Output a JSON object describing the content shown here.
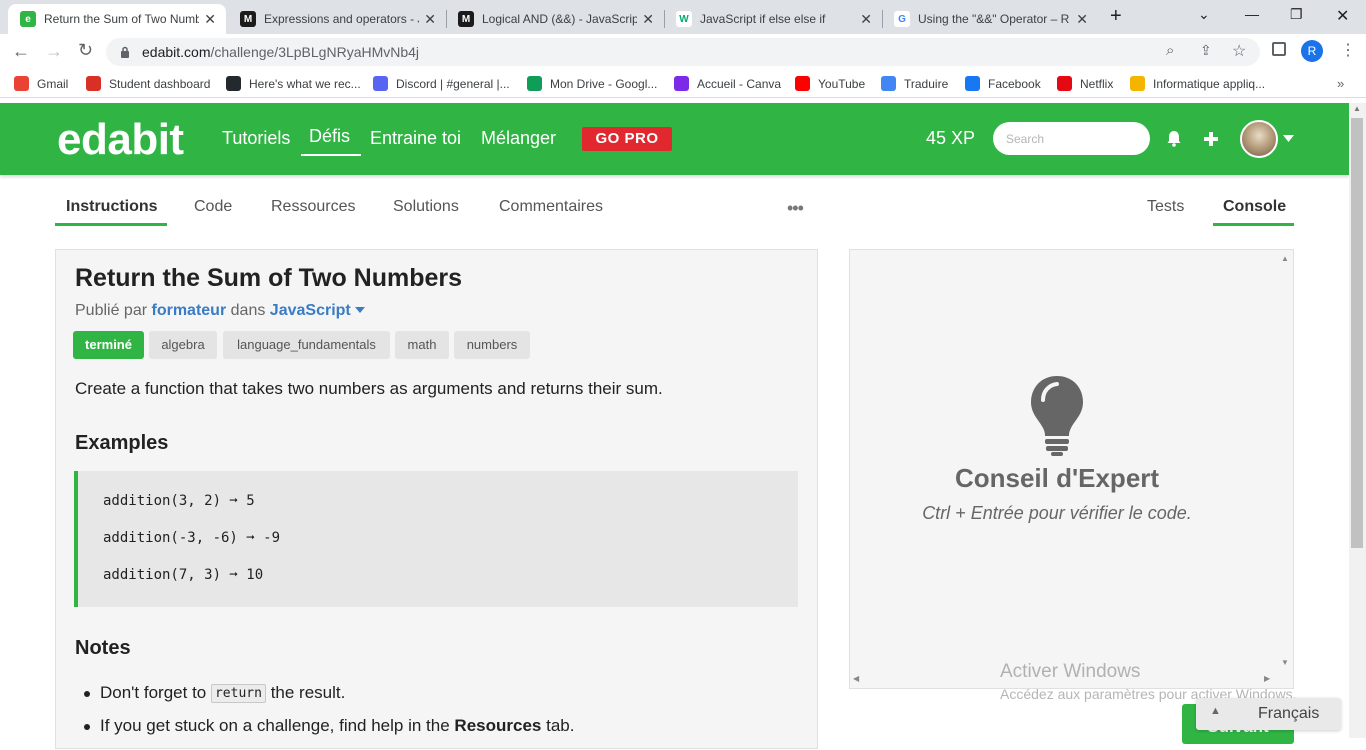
{
  "browser": {
    "tabs": [
      {
        "title": "Return the Sum of Two Numb",
        "favicon_color": "#30b545",
        "favicon_letter": "e"
      },
      {
        "title": "Expressions and operators - J",
        "favicon_color": "#1b1b1b",
        "favicon_letter": "M"
      },
      {
        "title": "Logical AND (&&) - JavaScrip",
        "favicon_color": "#1b1b1b",
        "favicon_letter": "M"
      },
      {
        "title": "JavaScript if else else if",
        "favicon_color": "#04aa6d",
        "favicon_letter": "W"
      },
      {
        "title": "Using the \"&&\" Operator – R",
        "favicon_color": "#4285f4",
        "favicon_letter": "G"
      }
    ],
    "new_tab": "+",
    "url_host": "edabit.com",
    "url_path": "/challenge/3LpBLgNRyaHMvNb4j",
    "profile_letter": "R",
    "bookmarks": [
      {
        "label": "Gmail",
        "color": "#ea4335",
        "icon": "gmail-icon"
      },
      {
        "label": "Student dashboard",
        "color": "#d93025",
        "icon": "dashboard-icon"
      },
      {
        "label": "Here's what we rec...",
        "color": "#24292e",
        "icon": "github-icon"
      },
      {
        "label": "Discord | #general |...",
        "color": "#5865f2",
        "icon": "discord-icon"
      },
      {
        "label": "Mon Drive - Googl...",
        "color": "#0f9d58",
        "icon": "drive-icon"
      },
      {
        "label": "Accueil - Canva",
        "color": "#7d2ae8",
        "icon": "canva-icon"
      },
      {
        "label": "YouTube",
        "color": "#ff0000",
        "icon": "youtube-icon"
      },
      {
        "label": "Traduire",
        "color": "#4285f4",
        "icon": "translate-icon"
      },
      {
        "label": "Facebook",
        "color": "#1877f2",
        "icon": "facebook-icon"
      },
      {
        "label": "Netflix",
        "color": "#e50914",
        "icon": "netflix-icon"
      },
      {
        "label": "Informatique appliq...",
        "color": "#f4b400",
        "icon": "classroom-icon"
      }
    ]
  },
  "site": {
    "logo": "edabit",
    "brand_color": "#30b545",
    "nav": [
      "Tutoriels",
      "Défis",
      "Entraine toi",
      "Mélanger"
    ],
    "go_pro": "GO PRO",
    "xp": "45 XP",
    "search_placeholder": "Search"
  },
  "page_tabs": {
    "left": [
      "Instructions",
      "Code",
      "Ressources",
      "Solutions",
      "Commentaires"
    ],
    "more": "•••",
    "right": [
      "Tests",
      "Console"
    ]
  },
  "challenge": {
    "title": "Return the Sum of Two Numbers",
    "published_by": "Publié par",
    "author": "formateur",
    "in": "dans",
    "language": "JavaScript",
    "tags": [
      "terminé",
      "algebra",
      "language_fundamentals",
      "math",
      "numbers"
    ],
    "description": "Create a function that takes two numbers as arguments and returns their sum.",
    "examples_heading": "Examples",
    "examples": [
      "addition(3, 2) ➞ 5",
      "addition(-3, -6) ➞ -9",
      "addition(7, 3) ➞ 10"
    ],
    "notes_heading": "Notes",
    "note1_before": "Don't forget to",
    "note1_code": "return",
    "note1_after": "the result.",
    "note2_before": "If you get stuck on a challenge, find help in the",
    "note2_bold": "Resources",
    "note2_after": "tab."
  },
  "console_panel": {
    "tip_title": "Conseil d'Expert",
    "tip_text": "Ctrl + Entrée pour vérifier le code."
  },
  "watermark": {
    "line1": "Activer Windows",
    "line2": "Accédez aux paramètres pour activer Windows."
  },
  "next_button": "Suivant",
  "language_selector": "Français"
}
